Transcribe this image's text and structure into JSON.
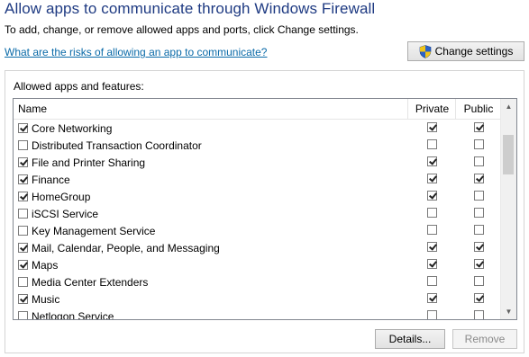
{
  "header": {
    "title": "Allow apps to communicate through Windows Firewall",
    "subtitle": "To add, change, or remove allowed apps and ports, click Change settings.",
    "risk_link": "What are the risks of allowing an app to communicate?",
    "change_settings_label": "Change settings",
    "shield_icon": "uac-shield-icon"
  },
  "apps_group": {
    "label": "Allowed apps and features:",
    "columns": {
      "name": "Name",
      "private": "Private",
      "public": "Public"
    },
    "rows": [
      {
        "name": "Core Networking",
        "enabled": true,
        "private": true,
        "public": true
      },
      {
        "name": "Distributed Transaction Coordinator",
        "enabled": false,
        "private": false,
        "public": false
      },
      {
        "name": "File and Printer Sharing",
        "enabled": true,
        "private": true,
        "public": false
      },
      {
        "name": "Finance",
        "enabled": true,
        "private": true,
        "public": true
      },
      {
        "name": "HomeGroup",
        "enabled": true,
        "private": true,
        "public": false
      },
      {
        "name": "iSCSI Service",
        "enabled": false,
        "private": false,
        "public": false
      },
      {
        "name": "Key Management Service",
        "enabled": false,
        "private": false,
        "public": false
      },
      {
        "name": "Mail, Calendar, People, and Messaging",
        "enabled": true,
        "private": true,
        "public": true
      },
      {
        "name": "Maps",
        "enabled": true,
        "private": true,
        "public": true
      },
      {
        "name": "Media Center Extenders",
        "enabled": false,
        "private": false,
        "public": false
      },
      {
        "name": "Music",
        "enabled": true,
        "private": true,
        "public": true
      },
      {
        "name": "Netlogon Service",
        "enabled": false,
        "private": false,
        "public": false
      }
    ],
    "scroll_up_glyph": "▲",
    "scroll_down_glyph": "▼"
  },
  "footer": {
    "details_label": "Details...",
    "remove_label": "Remove"
  },
  "colors": {
    "title": "#1e3a82",
    "link": "#0a6aa8"
  }
}
